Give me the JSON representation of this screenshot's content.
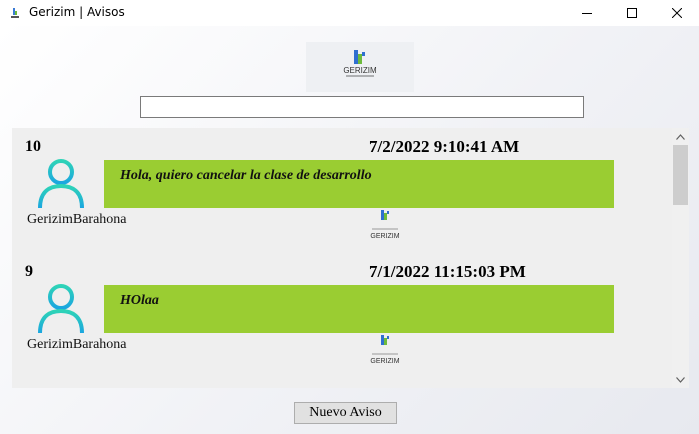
{
  "window": {
    "title": "Gerizim | Avisos",
    "icon": "gerizim-logo-icon",
    "controls": [
      "minimize-icon",
      "maximize-icon",
      "close-icon"
    ]
  },
  "header": {
    "logo_text": "GERIZIM"
  },
  "search": {
    "value": "",
    "placeholder": ""
  },
  "posts": [
    {
      "id": "10",
      "date": "7/2/2022 9:10:41 AM",
      "message": "Hola, quiero cancelar la clase de desarrollo",
      "user": "GerizimBarahona",
      "logo_text": "GERIZIM"
    },
    {
      "id": "9",
      "date": "7/1/2022 11:15:03 PM",
      "message": "HOlaa",
      "user": "GerizimBarahona",
      "logo_text": "GERIZIM"
    }
  ],
  "footer": {
    "new_button_label": "Nuevo Aviso"
  },
  "colors": {
    "bubble": "#9acd32",
    "avatar_gradient_top": "#2ed3b7",
    "avatar_gradient_bottom": "#1ba6e0",
    "feed_background": "#efefef"
  }
}
